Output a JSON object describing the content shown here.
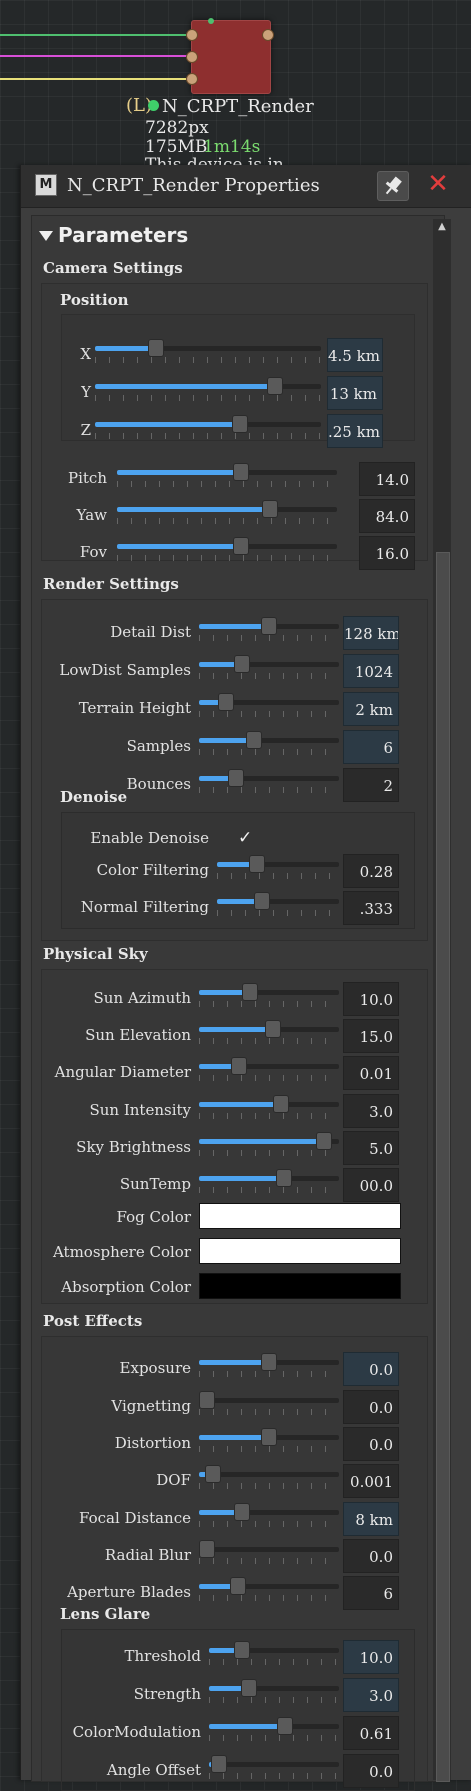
{
  "node": {
    "load_tag": "(L)",
    "name": "N_CRPT_Render",
    "resolution": "7282px",
    "memory": "175MB",
    "time": "1m14s",
    "note": "This device is in"
  },
  "panel": {
    "title": "N_CRPT_Render Properties",
    "title_icon_text": "M",
    "pin_label": "📌",
    "close_label": "✕",
    "parameters_label": "Parameters",
    "scroll_up_label": "▲"
  },
  "camera": {
    "heading": "Camera Settings",
    "position_heading": "Position",
    "x": {
      "label": "X",
      "value": "4.5 km",
      "level": 0.25
    },
    "y": {
      "label": "Y",
      "value": "13 km",
      "level": 0.82
    },
    "z": {
      "label": "Z",
      "value": ".25 km",
      "level": 0.65
    },
    "pitch": {
      "label": "Pitch",
      "value": "14.0",
      "level": 0.57
    },
    "yaw": {
      "label": "Yaw",
      "value": "84.0",
      "level": 0.71
    },
    "fov": {
      "label": "Fov",
      "value": "16.0",
      "level": 0.57
    }
  },
  "render": {
    "heading": "Render Settings",
    "detail_dist": {
      "label": "Detail Dist",
      "value": "128 km",
      "level": 0.5
    },
    "lowdist_samples": {
      "label": "LowDist Samples",
      "value": "1024",
      "level": 0.28
    },
    "terrain_height": {
      "label": "Terrain Height",
      "value": "2 km",
      "level": 0.15
    },
    "samples": {
      "label": "Samples",
      "value": "6",
      "level": 0.38
    },
    "bounces": {
      "label": "Bounces",
      "value": "2",
      "level": 0.23
    }
  },
  "denoise": {
    "heading": "Denoise",
    "enable": {
      "label": "Enable Denoise",
      "checkmark": "✓"
    },
    "color_filtering": {
      "label": "Color Filtering",
      "value": "0.28",
      "level": 0.3
    },
    "normal_filtering": {
      "label": "Normal Filtering",
      "value": ".333",
      "level": 0.35
    }
  },
  "sky": {
    "heading": "Physical Sky",
    "sun_azimuth": {
      "label": "Sun Azimuth",
      "value": "10.0",
      "level": 0.35
    },
    "sun_elevation": {
      "label": "Sun Elevation",
      "value": "15.0",
      "level": 0.53
    },
    "angular_diameter": {
      "label": "Angular Diameter",
      "value": "0.01",
      "level": 0.26
    },
    "sun_intensity": {
      "label": "Sun Intensity",
      "value": "3.0",
      "level": 0.6
    },
    "sky_brightness": {
      "label": "Sky Brightness",
      "value": "5.0",
      "level": 0.94
    },
    "suntemp": {
      "label": "SunTemp",
      "value": "00.0",
      "level": 0.62
    },
    "fog_color": {
      "label": "Fog Color",
      "color": "#ffffff"
    },
    "atmosphere_color": {
      "label": "Atmosphere Color",
      "color": "#ffffff"
    },
    "absorption_color": {
      "label": "Absorption Color",
      "color": "#000000"
    }
  },
  "post": {
    "heading": "Post Effects",
    "exposure": {
      "label": "Exposure",
      "value": "0.0",
      "level": 0.5
    },
    "vignetting": {
      "label": "Vignetting",
      "value": "0.0",
      "level": 0.0
    },
    "distortion": {
      "label": "Distortion",
      "value": "0.0",
      "level": 0.5
    },
    "dof": {
      "label": "DOF",
      "value": "0.001",
      "level": 0.05
    },
    "focal_distance": {
      "label": "Focal Distance",
      "value": "8 km",
      "level": 0.28
    },
    "radial_blur": {
      "label": "Radial Blur",
      "value": "0.0",
      "level": 0.0
    },
    "aperture_blades": {
      "label": "Aperture Blades",
      "value": "6",
      "level": 0.25
    }
  },
  "glare": {
    "heading": "Lens Glare",
    "threshold": {
      "label": "Threshold",
      "value": "10.0",
      "level": 0.22
    },
    "strength": {
      "label": "Strength",
      "value": "3.0",
      "level": 0.28
    },
    "color_modulation": {
      "label": "ColorModulation",
      "value": "0.61",
      "level": 0.6
    },
    "angle_offset": {
      "label": "Angle Offset",
      "value": "0.0",
      "level": 0.02
    }
  },
  "colors": {
    "accent": "#4da3ef",
    "node_body": "#8e2f2f",
    "close": "#e23d3d",
    "wire_green": "#4fbf6f",
    "wire_magenta": "#d84fd8",
    "wire_yellow": "#e8e07a",
    "status_time": "#7bdc6f"
  }
}
